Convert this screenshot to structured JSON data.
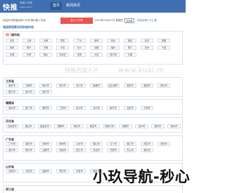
{
  "header": {
    "logo": "快推",
    "logo_sub": "百城人才网",
    "logo_url": "www.kuai.m",
    "nav": [
      "首页",
      "新闻资讯"
    ]
  },
  "welcome": {
    "text": "欢迎访问快推百城人才网  提示输入内容:",
    "button": "进入人才网",
    "date": "2023年09月07日 星期四",
    "select": "请选择",
    "note": "本站百城人才汇集"
  },
  "page_title": "请选择您要访问的城市站",
  "sections": [
    {
      "title_hot": "热门",
      "title": "城市站",
      "tags": [
        "北京",
        "上海",
        "天津",
        "重庆",
        "广州",
        "深圳",
        "杭州",
        "南京",
        "武汉",
        "成都",
        "西安",
        "郑州",
        "济南",
        "青岛",
        "长沙",
        "合肥",
        "福州",
        "厦门",
        "苏州",
        "宁波",
        "无锡",
        "东莞",
        "佛山",
        "石家庄",
        "沈阳",
        "大连",
        "哈尔滨",
        "长春"
      ]
    },
    {
      "title": "江苏省",
      "tags": [
        "南京市",
        "无锡市",
        "徐州市",
        "常州市",
        "苏州市",
        "南通市",
        "连云港市",
        "淮安市",
        "盐城市",
        "扬州市",
        "镇江市",
        "泰州市",
        "宿迁市"
      ]
    },
    {
      "title": "福建省",
      "tags": [
        "福州市",
        "厦门市",
        "莆田市",
        "三明市",
        "泉州市",
        "漳州市",
        "南平市",
        "龙岩市",
        "宁德市"
      ]
    },
    {
      "title": "河北省",
      "tags": [
        "石家庄市",
        "唐山市",
        "秦皇岛市",
        "邯郸市",
        "邢台市",
        "保定市",
        "张家口市",
        "承德市",
        "沧州市",
        "廊坊市",
        "衡水市"
      ]
    },
    {
      "title": "广东省",
      "tags": [
        "广州市",
        "韶关市",
        "深圳市",
        "珠海市",
        "汕头市",
        "佛山市",
        "江门市",
        "湛江市",
        "茂名市",
        "肇庆市",
        "惠州市",
        "梅州市",
        "汕尾市",
        "河源市",
        "阳江市",
        "清远市",
        "东莞市",
        "中山市",
        "潮州市"
      ]
    },
    {
      "title": "山东省",
      "tags": [
        "济南市",
        "青岛市",
        "淄博市",
        "枣庄市",
        "东营市",
        "烟台市"
      ]
    },
    {
      "title": "浙江省",
      "tags": []
    }
  ],
  "banner": {
    "cn": "快推百城人才",
    "url": "www.kuai.m"
  },
  "watermark": "小玖导航-秒心",
  "colors": {
    "header": "#3f6fb0",
    "button": "#e8554e",
    "link": "#3f6fb0"
  }
}
